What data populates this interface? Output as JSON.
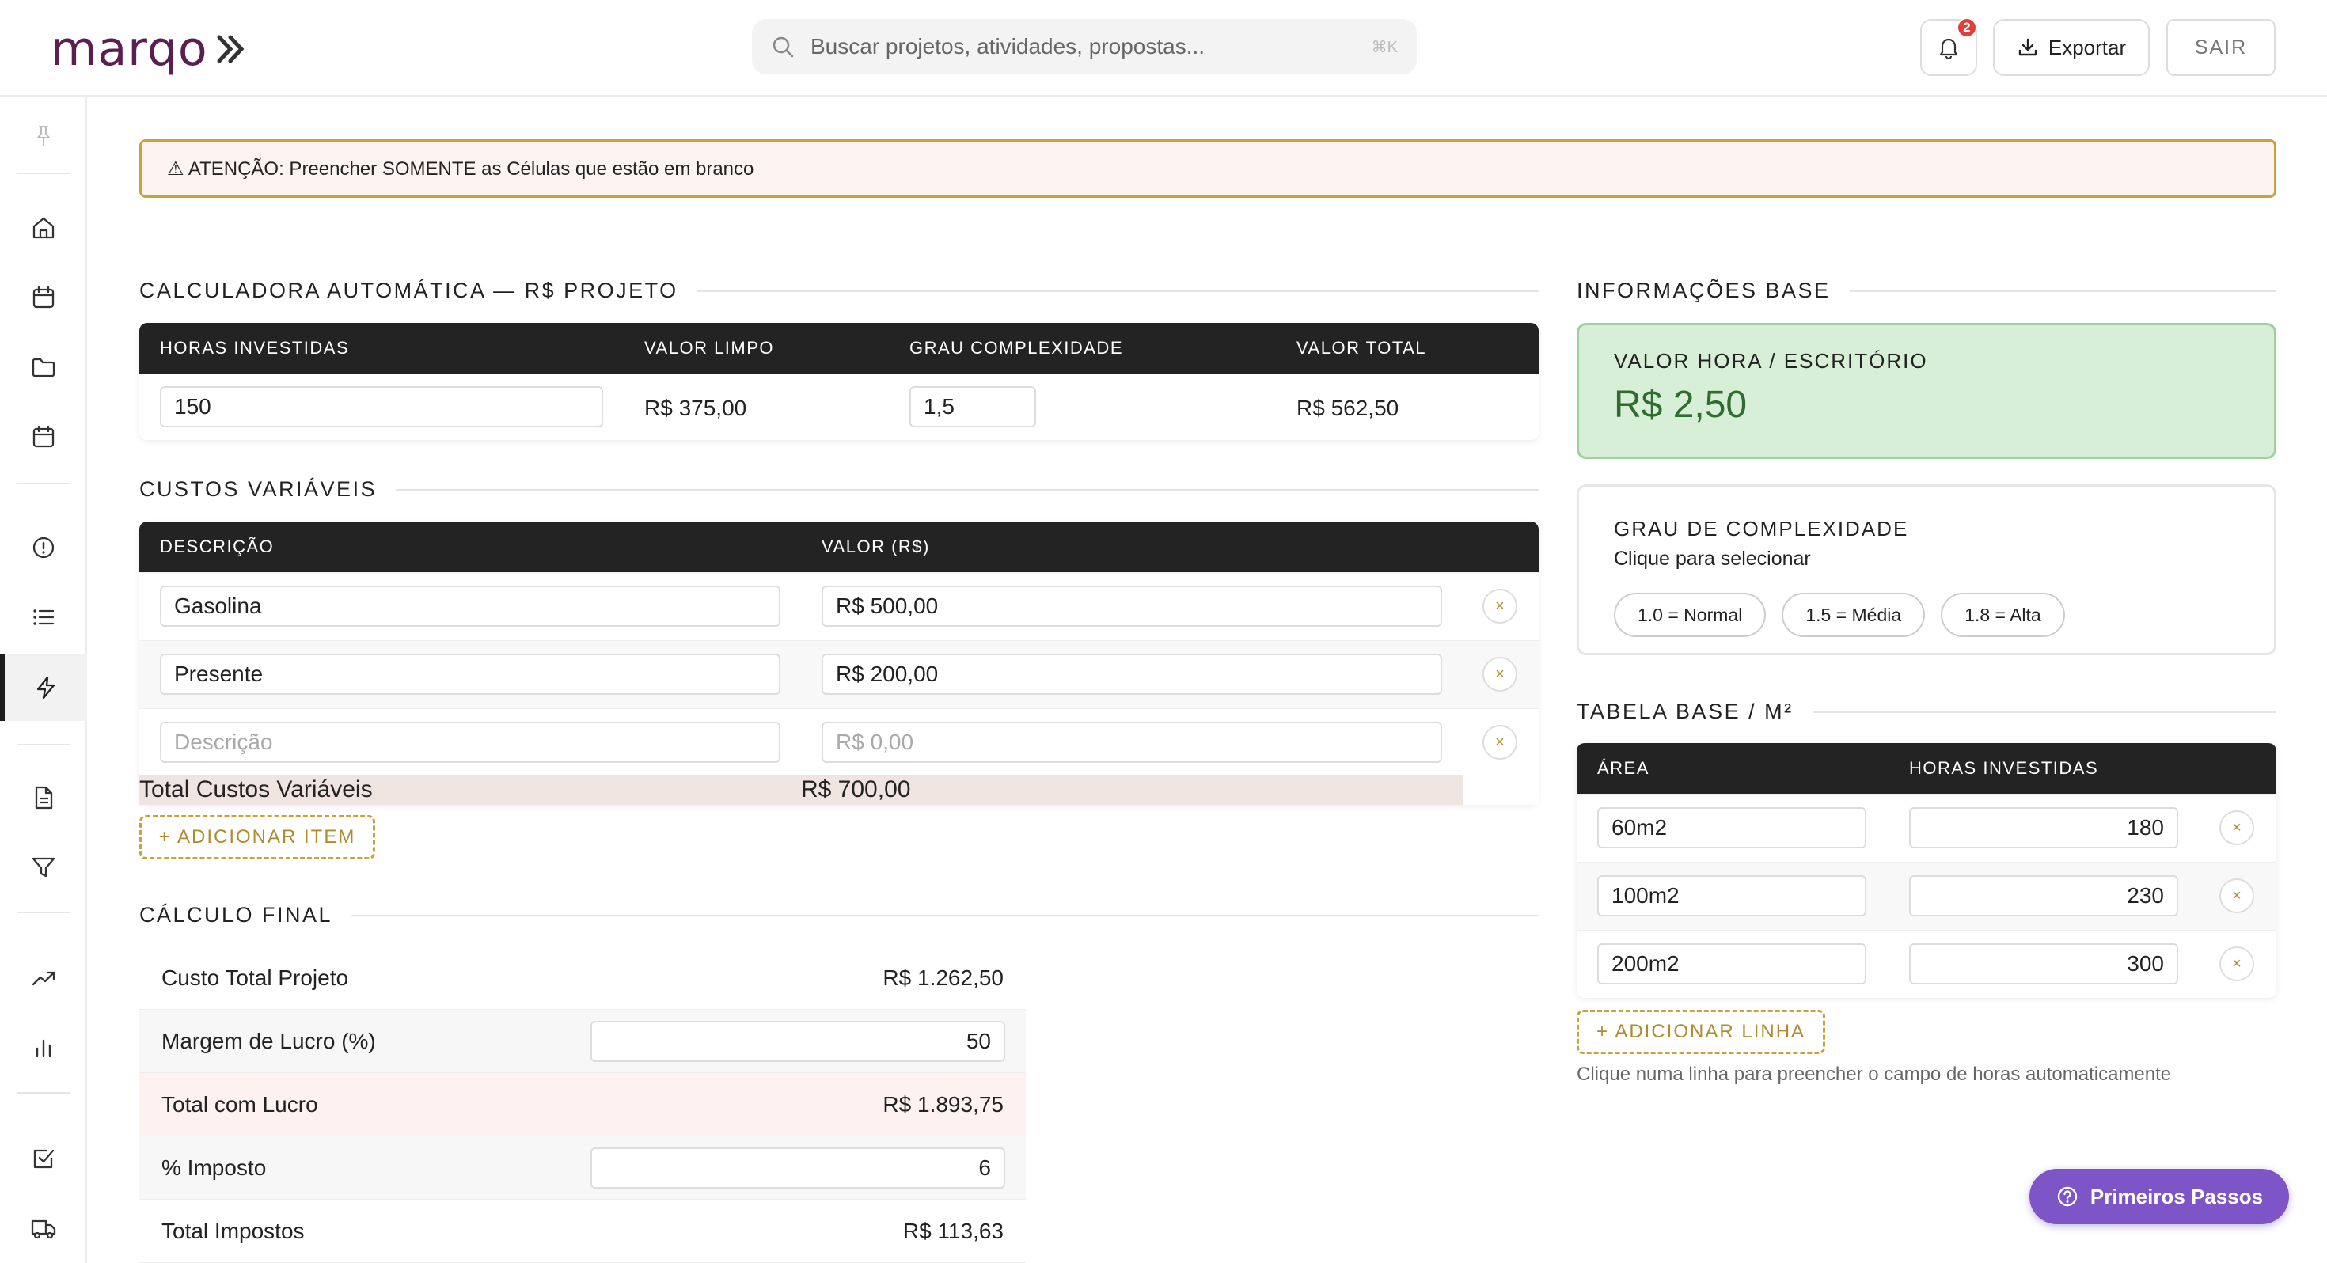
{
  "header": {
    "logo_text": "marqo",
    "search_placeholder": "Buscar projetos, atividades, propostas...",
    "search_shortcut": "⌘K",
    "notification_count": "2",
    "export_label": "Exportar",
    "logout_label": "SAIR"
  },
  "sidebar": {
    "icons": [
      "pin-icon",
      "home-icon",
      "calendar-icon",
      "folder-icon",
      "calendar-icon",
      "alert-circle-icon",
      "list-icon",
      "lightning-icon",
      "document-icon",
      "filter-icon",
      "trending-up-icon",
      "bar-chart-icon",
      "checkbox-icon",
      "truck-icon"
    ],
    "active": "lightning-icon"
  },
  "alert": {
    "text": "⚠ ATENÇÃO: Preencher SOMENTE as Células que estão em branco"
  },
  "calculator": {
    "title": "CALCULADORA AUTOMÁTICA — R$ PROJETO",
    "headers": {
      "hours": "HORAS INVESTIDAS",
      "clean": "VALOR LIMPO",
      "complexity": "GRAU COMPLEXIDADE",
      "total": "VALOR TOTAL"
    },
    "hours": "150",
    "clean_value": "R$ 375,00",
    "complexity": "1,5",
    "total_value": "R$ 562,50"
  },
  "variable_costs": {
    "title": "CUSTOS VARIÁVEIS",
    "headers": {
      "description": "DESCRIÇÃO",
      "value": "VALOR (R$)"
    },
    "items": [
      {
        "description": "Gasolina",
        "value": "R$ 500,00"
      },
      {
        "description": "Presente",
        "value": "R$ 200,00"
      },
      {
        "description": "",
        "value": ""
      }
    ],
    "placeholder_description": "Descrição",
    "placeholder_value": "R$ 0,00",
    "remove_symbol": "×",
    "total_label": "Total Custos Variáveis",
    "total_value": "R$ 700,00",
    "add_label": "+ ADICIONAR ITEM"
  },
  "final_calc": {
    "title": "CÁLCULO FINAL",
    "project_total_label": "Custo Total Projeto",
    "project_total_value": "R$ 1.262,50",
    "margin_label": "Margem de Lucro (%)",
    "margin_value": "50",
    "with_profit_label": "Total com Lucro",
    "with_profit_value": "R$ 1.893,75",
    "tax_label": "% Imposto",
    "tax_value": "6",
    "taxes_total_label": "Total Impostos",
    "taxes_total_value": "R$ 113,63"
  },
  "base_info": {
    "title": "INFORMAÇÕES BASE",
    "hour_value_label": "VALOR HORA / ESCRITÓRIO",
    "hour_value": "R$ 2,50",
    "complexity_title": "GRAU DE COMPLEXIDADE",
    "complexity_subtitle": "Clique para selecionar",
    "chips": [
      "1.0 = Normal",
      "1.5 = Média",
      "1.8 = Alta"
    ]
  },
  "base_table": {
    "title": "TABELA BASE / M²",
    "headers": {
      "area": "ÁREA",
      "hours": "HORAS INVESTIDAS"
    },
    "rows": [
      {
        "area": "60m2",
        "hours": "180"
      },
      {
        "area": "100m2",
        "hours": "230"
      },
      {
        "area": "200m2",
        "hours": "300"
      }
    ],
    "add_label": "+ ADICIONAR LINHA",
    "hint": "Clique numa linha para preencher o campo de horas automaticamente"
  },
  "help": {
    "label": "Primeiros Passos"
  },
  "colors": {
    "accent_gold": "#c9a23c",
    "brand_purple": "#5b1f4f",
    "help_purple": "#7d55c7",
    "success_green": "#2f6c2f"
  }
}
